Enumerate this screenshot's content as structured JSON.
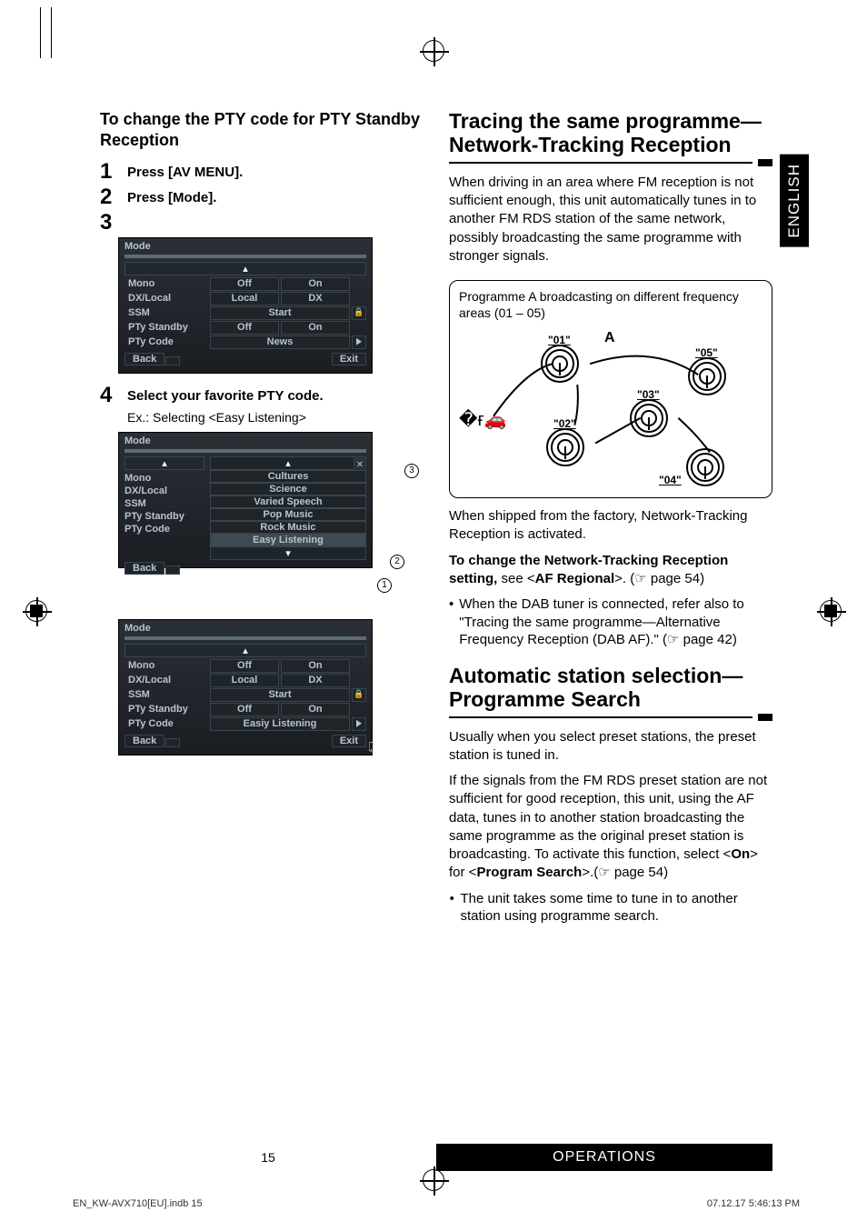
{
  "language_tab": "ENGLISH",
  "left": {
    "heading": "To change the PTY code for PTY Standby Reception",
    "steps": {
      "s1": {
        "num": "1",
        "text": "Press [AV MENU]."
      },
      "s2": {
        "num": "2",
        "text": "Press [Mode]."
      },
      "s3": {
        "num": "3",
        "text": ""
      },
      "s4": {
        "num": "4",
        "text": "Select your favorite PTY code."
      }
    },
    "step4_sub": "Ex.: Selecting <Easy Listening>",
    "device_common": {
      "title": "Mode",
      "rows": {
        "mono": "Mono",
        "dxlocal": "DX/Local",
        "ssm": "SSM",
        "pty_standby": "PTy Standby",
        "pty_code": "PTy Code"
      },
      "off": "Off",
      "on": "On",
      "local": "Local",
      "dx": "DX",
      "start": "Start",
      "back": "Back",
      "exit": "Exit"
    },
    "device1_ptycode_value": "News",
    "device2_options": [
      "Cultures",
      "Science",
      "Varied Speech",
      "Pop Music",
      "Rock Music",
      "Easy Listening"
    ],
    "device3_ptycode_value": "Easiy Listening",
    "circles": {
      "c1": "1",
      "c2": "2",
      "c3": "3"
    }
  },
  "right": {
    "sect1_title": "Tracing the same programme—Network-Tracking Reception",
    "sect1_body": "When driving in an area where FM reception is not sufficient enough, this unit automatically tunes in to another FM RDS station of the same network, possibly broadcasting the same programme with stronger signals.",
    "diagram_caption": "Programme A broadcasting on different frequency areas (01 – 05)",
    "diagram_labels": {
      "a": "A",
      "n01": "\"01\"",
      "n02": "\"02\"",
      "n03": "\"03\"",
      "n04": "\"04\"",
      "n05": "\"05\""
    },
    "sect1_after1": "When shipped from the factory, Network-Tracking Reception is activated.",
    "sect1_after2_pre": "To change the Network-Tracking Reception setting, ",
    "sect1_after2_mid1": "see <",
    "sect1_after2_bold": "AF Regional",
    "sect1_after2_mid2": ">. (☞ page 54)",
    "sect1_bullet": "When the DAB tuner is connected, refer also to \"Tracing the same programme—Alternative Frequency Reception (DAB AF).\" (☞ page 42)",
    "sect2_title": "Automatic station selection—Programme Search",
    "sect2_body1": "Usually when you select preset stations, the preset station is tuned in.",
    "sect2_body2_pre": "If the signals from the FM RDS preset station are not sufficient for good reception, this unit, using the AF data, tunes in to another station broadcasting the same programme as the original preset station is broadcasting. To activate this function, select <",
    "sect2_body2_bold": "On",
    "sect2_body2_mid": "> for <",
    "sect2_body2_bold2": "Program Search",
    "sect2_body2_post": ">.(☞ page 54)",
    "sect2_bullet": "The unit takes some time to tune in to another station using programme search."
  },
  "footer": {
    "page_no": "15",
    "bar": "OPERATIONS",
    "meta_left": "EN_KW-AVX710[EU].indb   15",
    "meta_right": "07.12.17   5:46:13 PM"
  }
}
